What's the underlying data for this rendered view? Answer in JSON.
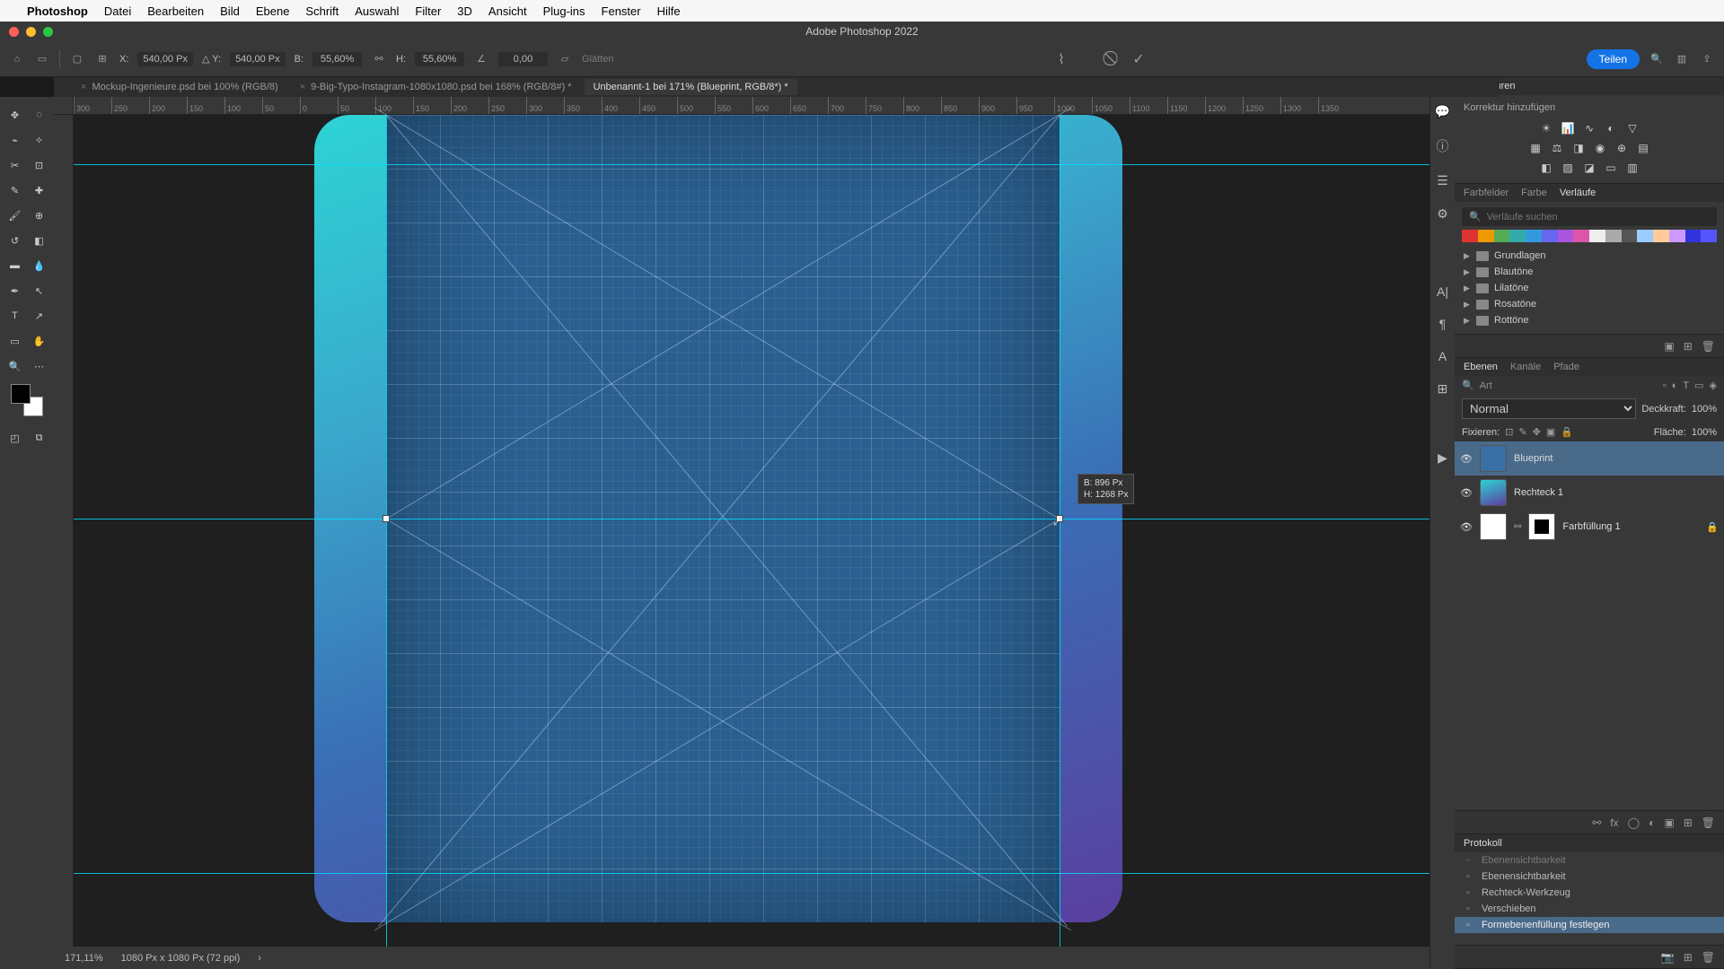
{
  "menubar": {
    "app": "Photoshop",
    "items": [
      "Datei",
      "Bearbeiten",
      "Bild",
      "Ebene",
      "Schrift",
      "Auswahl",
      "Filter",
      "3D",
      "Ansicht",
      "Plug-ins",
      "Fenster",
      "Hilfe"
    ]
  },
  "titlebar": {
    "title": "Adobe Photoshop 2022"
  },
  "options": {
    "x_label": "X:",
    "x": "540,00 Px",
    "y_label": "Y:",
    "y": "540,00 Px",
    "w_label": "B:",
    "w": "55,60%",
    "h_label": "H:",
    "h": "55,60%",
    "angle_label": "",
    "angle": "0,00",
    "interpolation": "Glätten",
    "share": "Teilen"
  },
  "tabs": [
    {
      "label": "Mockup-Ingenieure.psd bei 100% (RGB/8)",
      "active": false
    },
    {
      "label": "9-Big-Typo-Instagram-1080x1080.psd bei 168% (RGB/8#) *",
      "active": false
    },
    {
      "label": "Unbenannt-1 bei 171% (Blueprint, RGB/8*) *",
      "active": true
    }
  ],
  "ruler_ticks": [
    "300",
    "250",
    "200",
    "150",
    "100",
    "50",
    "0",
    "50",
    "100",
    "150",
    "200",
    "250",
    "300",
    "350",
    "400",
    "450",
    "500",
    "550",
    "600",
    "650",
    "700",
    "750",
    "800",
    "850",
    "900",
    "950",
    "1000",
    "1050",
    "1100",
    "1150",
    "1200",
    "1250",
    "1300",
    "1350"
  ],
  "measure_tip": {
    "w": "B: 896 Px",
    "h": "H: 1268 Px"
  },
  "status": {
    "zoom": "171,11%",
    "doc": "1080 Px x 1080 Px (72 ppi)"
  },
  "corrections": {
    "title": "Korrekturen",
    "add": "Korrektur hinzufügen"
  },
  "gradients": {
    "tabs": [
      "Farbfelder",
      "Farbe",
      "Verläufe"
    ],
    "active_tab": 2,
    "search_placeholder": "Verläufe suchen",
    "folders": [
      "Grundlagen",
      "Blautöne",
      "Lilatöne",
      "Rosatöne",
      "Rottöne"
    ],
    "strip_colors": [
      "#d33",
      "#e90",
      "#5a5",
      "#3aa",
      "#39d",
      "#66e",
      "#a5d",
      "#d5a",
      "#eee",
      "#aaa",
      "#555",
      "#9cf",
      "#fc9",
      "#c9f",
      "#33d",
      "#55f"
    ]
  },
  "layers_panel": {
    "tabs": [
      "Ebenen",
      "Kanäle",
      "Pfade"
    ],
    "active_tab": 0,
    "filter_placeholder": "Art",
    "blend": "Normal",
    "opacity_label": "Deckkraft:",
    "opacity": "100%",
    "lock_label": "Fixieren:",
    "fill_label": "Fläche:",
    "fill": "100%",
    "layers": [
      {
        "name": "Blueprint",
        "selected": true,
        "thumb": "blue"
      },
      {
        "name": "Rechteck 1",
        "selected": false,
        "thumb": "rect"
      },
      {
        "name": "Farbfüllung 1",
        "selected": false,
        "thumb": "fill",
        "mask": true,
        "locked": true
      }
    ]
  },
  "history": {
    "title": "Protokoll",
    "items": [
      {
        "name": "Ebenensichtbarkeit",
        "selected": false,
        "dim": true
      },
      {
        "name": "Ebenensichtbarkeit",
        "selected": false
      },
      {
        "name": "Rechteck-Werkzeug",
        "selected": false
      },
      {
        "name": "Verschieben",
        "selected": false
      },
      {
        "name": "Formebenenfüllung festlegen",
        "selected": true
      }
    ]
  }
}
